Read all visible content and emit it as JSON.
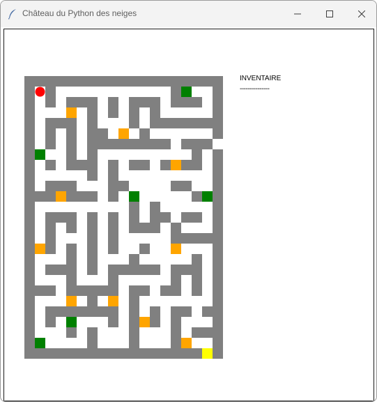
{
  "window": {
    "title": "Château du Python des neiges",
    "icon": "feather-icon",
    "controls": [
      "minimize-icon",
      "maximize-icon",
      "close-icon"
    ]
  },
  "inventory": {
    "title": "INVENTAIRE",
    "separator": "---------------"
  },
  "colors": {
    "wall": "#808080",
    "path": "#ffffff",
    "player": "#ff0000",
    "exit": "#ffff00",
    "key": "#ffa500",
    "door": "#008000"
  },
  "maze": {
    "legend": {
      "#": "wall",
      ".": "path",
      "P": "player",
      "S": "exit",
      "O": "key",
      "G": "door"
    },
    "rows": [
      "###################",
      "#P#...........#G..#",
      "#.#.###.#.###.###.#",
      "#...O.#.#.#.#.....#",
      "#.###.#...#.#######",
      "#.#.#.##.O.#......#",
      "#.#.#.########.###.",
      "#G..#.#.........#.#",
      "#.#.###.#.##.#O##.#",
      "#.....#.#.........#",
      "#.###...##....##..#",
      "###O###.#.G.....#G#",
      "#.........#.#.....#",
      "#.###.#.#.#.##.##.#",
      "#.#.#.#.#.###.#...#",
      "#.#...#.#.....#####",
      "#O#.#.#.#..#..O...#",
      "#...#.#...#.....#.#",
      "#.###.#.#####.###.#",
      "#...#...#.....#.#.#",
      "###.#####.##.##.#.#",
      "#...O.#.O.#.......#",
      "#.#######.#.#.##.##",
      "#.#.G...#.#O#.#...#",
      "#...#.#...#...#.###",
      "#G....#...#...#O..#",
      "###################"
    ],
    "exit_marker": "S"
  }
}
